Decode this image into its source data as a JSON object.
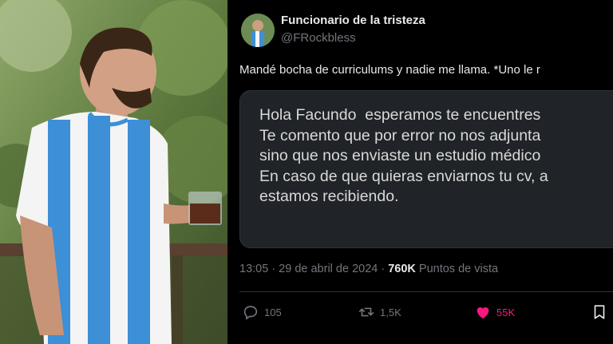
{
  "tweet": {
    "display_name": "Funcionario de la tristeza",
    "handle": "@FRockbless",
    "text": "Mandé bocha de curriculums y nadie me llama. *Uno le r",
    "quoted_message": {
      "lines": [
        "Hola Facundo  esperamos te encuentres",
        "Te comento que por error no nos adjunta",
        "sino que nos enviaste un estudio médico",
        "En caso de que quieras enviarnos tu cv, a",
        "estamos recibiendo."
      ]
    },
    "meta": {
      "time_date": "13:05 · 29 de abril de 2024 · ",
      "views": "760K",
      "views_label": " Puntos de vista"
    },
    "actions": {
      "replies": "105",
      "retweets": "1,5K",
      "likes": "55K"
    }
  },
  "icons": {
    "reply": "reply-icon",
    "retweet": "retweet-icon",
    "like": "heart-icon",
    "bookmark": "bookmark-icon"
  },
  "colors": {
    "background": "#000000",
    "card": "#202327",
    "muted": "#71767b",
    "like": "#f91880",
    "jersey_blue": "#3d8fd6"
  }
}
